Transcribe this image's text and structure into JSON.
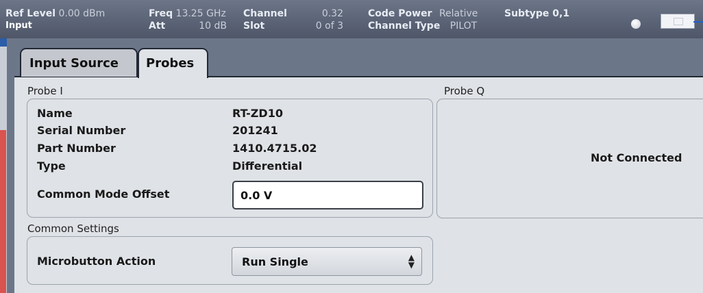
{
  "status_bar": {
    "ref_level_label": "Ref Level",
    "ref_level_value": "0.00 dBm",
    "input_label": "Input",
    "freq_label": "Freq",
    "freq_value": "13.25 GHz",
    "att_label": "Att",
    "att_value": "10 dB",
    "channel_label": "Channel",
    "channel_value": "0.32",
    "slot_label": "Slot",
    "slot_value": "0 of 3",
    "code_power_label": "Code Power",
    "code_power_value": "Relative",
    "channel_type_label": "Channel Type",
    "channel_type_value": "PILOT",
    "subtype_label": "Subtype 0,1"
  },
  "tabs": [
    {
      "label": "Input Source",
      "active": false
    },
    {
      "label": "Probes",
      "active": true
    }
  ],
  "probe_i": {
    "title": "Probe I",
    "rows": [
      {
        "label": "Name",
        "value": "RT-ZD10"
      },
      {
        "label": "Serial Number",
        "value": "201241"
      },
      {
        "label": "Part Number",
        "value": "1410.4715.02"
      },
      {
        "label": "Type",
        "value": "Differential"
      }
    ],
    "offset_label": "Common Mode Offset",
    "offset_value": "0.0 V"
  },
  "probe_q": {
    "title": "Probe Q",
    "status": "Not Connected"
  },
  "common_settings": {
    "title": "Common Settings",
    "microbutton_label": "Microbutton Action",
    "microbutton_value": "Run Single"
  },
  "colors": {
    "status_bar_bg": "#5b6476",
    "dialog_frame": "#6b7789",
    "panel_bg": "#dfe2e6",
    "accent_blue": "#1f5fd1"
  }
}
